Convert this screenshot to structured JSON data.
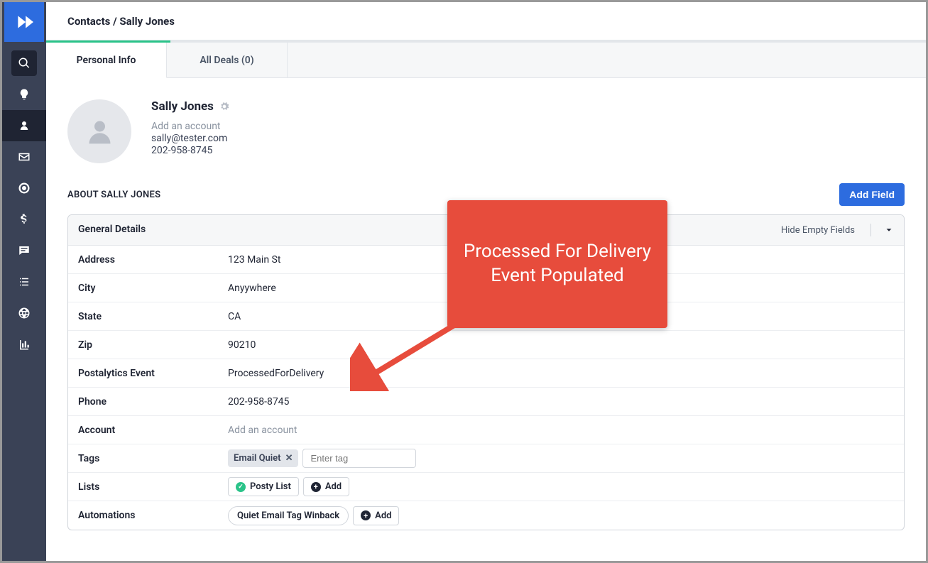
{
  "breadcrumb": {
    "path": "Contacts / Sally Jones"
  },
  "tabs": {
    "personal": "Personal Info",
    "deals": "All Deals (0)"
  },
  "contact": {
    "name": "Sally Jones",
    "add_account": "Add an account",
    "email": "sally@tester.com",
    "phone": "202-958-8745"
  },
  "about": {
    "heading": "ABOUT SALLY JONES",
    "add_field": "Add Field",
    "panel_title": "General Details",
    "hide_empty": "Hide Empty Fields"
  },
  "details": {
    "address": {
      "label": "Address",
      "value": "123 Main St"
    },
    "city": {
      "label": "City",
      "value": "Anyywhere"
    },
    "state": {
      "label": "State",
      "value": "CA"
    },
    "zip": {
      "label": "Zip",
      "value": "90210"
    },
    "postalytics": {
      "label": "Postalytics Event",
      "value": "ProcessedForDelivery"
    },
    "phone": {
      "label": "Phone",
      "value": "202-958-8745"
    },
    "account": {
      "label": "Account",
      "placeholder": "Add an account"
    },
    "tags": {
      "label": "Tags",
      "tag": "Email Quiet",
      "input_placeholder": "Enter tag"
    },
    "lists": {
      "label": "Lists",
      "item": "Posty List",
      "add": "Add"
    },
    "automations": {
      "label": "Automations",
      "item": "Quiet Email Tag Winback",
      "add": "Add"
    }
  },
  "callout": {
    "text": "Processed For Delivery Event Populated"
  }
}
